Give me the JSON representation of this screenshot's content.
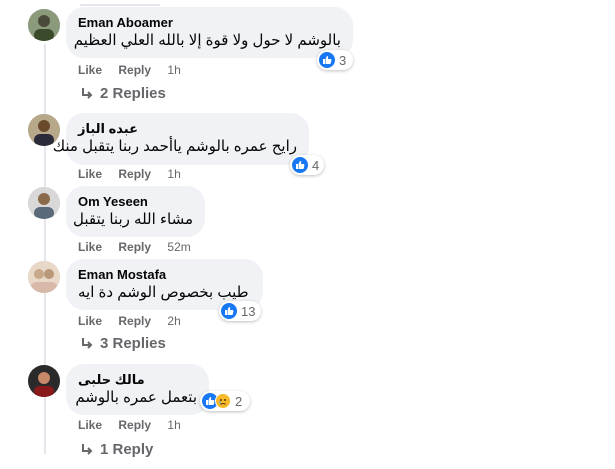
{
  "comments": [
    {
      "author": "Eman Aboamer",
      "text": "بالوشم لا حول ولا قوة إلا بالله العلي العظيم",
      "reaction_count": "3",
      "like_label": "Like",
      "reply_label": "Reply",
      "time": "1h",
      "replies_label": "2 Replies"
    },
    {
      "author": "عبده الباز",
      "text": "رايح عمره بالوشم ياأحمد ربنا يتقبل منك",
      "reaction_count": "4",
      "like_label": "Like",
      "reply_label": "Reply",
      "time": "1h"
    },
    {
      "author": "Om Yeseen",
      "text": "مشاء الله ربنا يتقبل",
      "like_label": "Like",
      "reply_label": "Reply",
      "time": "52m"
    },
    {
      "author": "Eman Mostafa",
      "text": "طيب بخصوص الوشم دة ايه",
      "reaction_count": "13",
      "like_label": "Like",
      "reply_label": "Reply",
      "time": "2h",
      "replies_label": "3 Replies"
    },
    {
      "author": "مالك حلبى",
      "text": "بتعمل عمره بالوشم",
      "reaction_count": "2",
      "like_label": "Like",
      "reply_label": "Reply",
      "time": "1h",
      "replies_label": "1 Reply"
    }
  ],
  "colors": {
    "bubble": "#f0f2f5",
    "like_blue": "#1877f2",
    "sad_yellow": "#f7b928",
    "meta_gray": "#65676b"
  },
  "icons": {
    "like": "thumbs-up-icon",
    "sad": "sad-face-icon",
    "reply": "reply-arrow-icon"
  }
}
